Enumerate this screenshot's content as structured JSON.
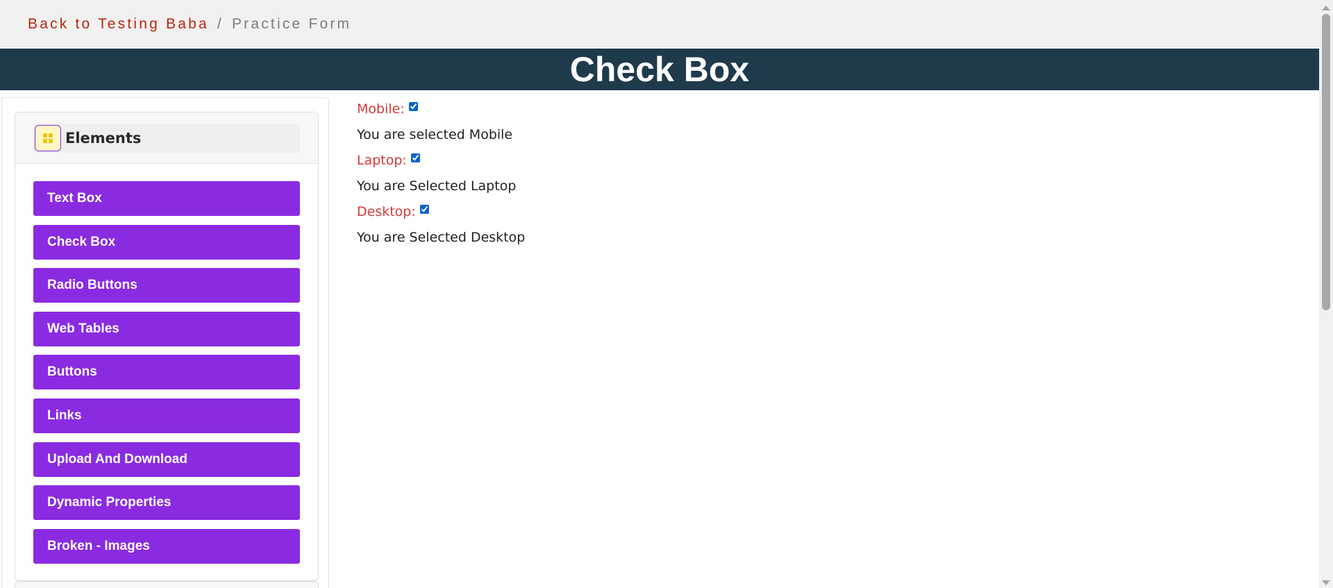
{
  "breadcrumb": {
    "back_link": "Back to Testing Baba",
    "separator": "/",
    "current": "Practice Form"
  },
  "header": {
    "title": "Check Box"
  },
  "sidebar": {
    "group_title": "Elements",
    "group_icon": "grid-icon",
    "items": [
      {
        "label": "Text Box"
      },
      {
        "label": "Check Box"
      },
      {
        "label": "Radio Buttons"
      },
      {
        "label": "Web Tables"
      },
      {
        "label": "Buttons"
      },
      {
        "label": "Links"
      },
      {
        "label": "Upload And Download"
      },
      {
        "label": "Dynamic Properties"
      },
      {
        "label": "Broken - Images"
      }
    ]
  },
  "checkboxes": [
    {
      "label": "Mobile:",
      "checked": true,
      "message": "You are selected Mobile"
    },
    {
      "label": "Laptop:",
      "checked": true,
      "message": "You are Selected Laptop"
    },
    {
      "label": "Desktop:",
      "checked": true,
      "message": "You are Selected Desktop"
    }
  ],
  "colors": {
    "breadcrumb_link": "#b9260f",
    "banner": "#1f3a4b",
    "menu_button": "#8a2be2",
    "checkbox_label": "#d23a3a"
  }
}
